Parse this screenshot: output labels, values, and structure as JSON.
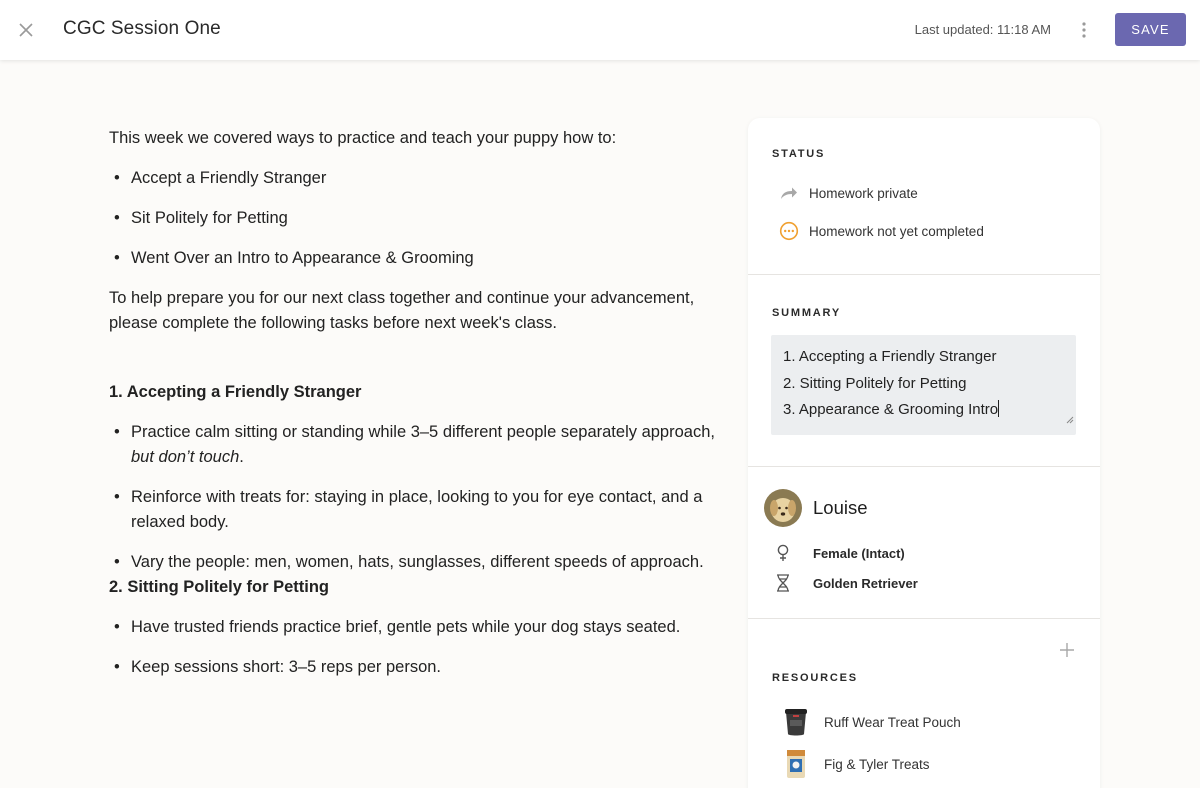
{
  "header": {
    "title": "CGC Session One",
    "last_updated": "Last updated: 11:18 AM",
    "save_label": "SAVE"
  },
  "content": {
    "intro": "This week we covered ways to practice and teach your puppy how to:",
    "covered": [
      "Accept a Friendly Stranger",
      "Sit Politely for Petting",
      "Went Over an Intro to Appearance & Grooming"
    ],
    "prep": "To help prepare you for our next class together and continue your advancement, please complete the following tasks before next week's class.",
    "section1": {
      "heading": "1. Accepting a Friendly Stranger",
      "item1_a": "Practice calm sitting or standing while 3–5 different people separately approach, ",
      "item1_b": "but don’t touch",
      "item1_c": ".",
      "item2": "Reinforce with treats for: staying in place, looking to you for eye contact, and a relaxed body.",
      "item3": "Vary the people: men, women, hats, sunglasses, different speeds of approach."
    },
    "section2": {
      "heading": "2. Sitting Politely for Petting",
      "item1": "Have trusted friends practice brief, gentle pets while your dog stays seated.",
      "item2": "Keep sessions short: 3–5 reps per person."
    }
  },
  "sidebar": {
    "status": {
      "label": "STATUS",
      "items": [
        {
          "text": "Homework private",
          "icon": "share-arrow-icon"
        },
        {
          "text": "Homework not yet completed",
          "icon": "pending-icon",
          "color": "#f0a030"
        }
      ]
    },
    "summary": {
      "label": "SUMMARY",
      "lines": [
        "1. Accepting a Friendly Stranger",
        "2. Sitting Politely for Petting",
        "3. Appearance & Grooming Intro"
      ]
    },
    "pet": {
      "name": "Louise",
      "sex": "Female (Intact)",
      "breed": "Golden Retriever"
    },
    "resources": {
      "label": "RESOURCES",
      "items": [
        {
          "name": "Ruff Wear Treat Pouch",
          "icon": "treat-pouch-thumbnail"
        },
        {
          "name": "Fig & Tyler Treats",
          "icon": "treats-bag-thumbnail"
        }
      ]
    }
  },
  "colors": {
    "accent": "#6b68b0",
    "pending": "#f0a030",
    "summary_bg": "#eceef0"
  }
}
